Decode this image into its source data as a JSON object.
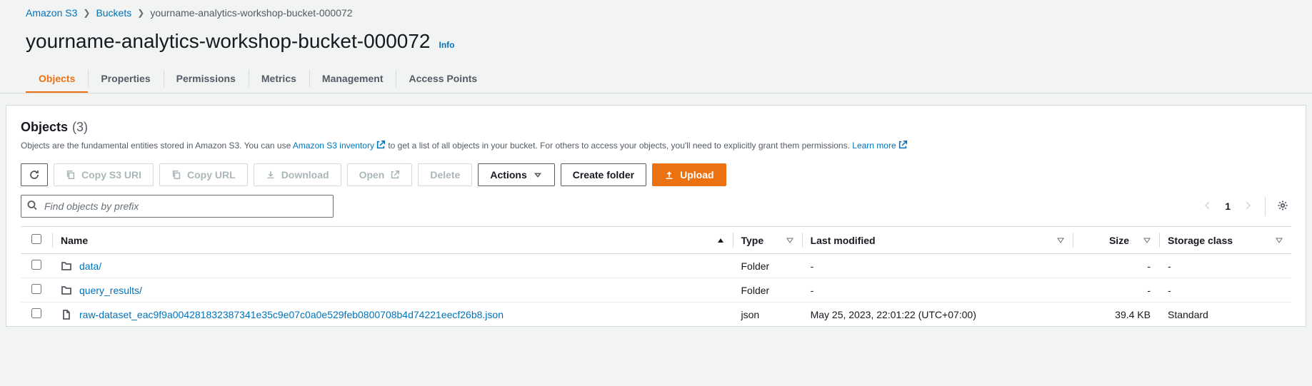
{
  "breadcrumb": {
    "root": "Amazon S3",
    "buckets": "Buckets",
    "current": "yourname-analytics-workshop-bucket-000072"
  },
  "header": {
    "title": "yourname-analytics-workshop-bucket-000072",
    "info_label": "Info"
  },
  "tabs": [
    {
      "label": "Objects",
      "active": true
    },
    {
      "label": "Properties"
    },
    {
      "label": "Permissions"
    },
    {
      "label": "Metrics"
    },
    {
      "label": "Management"
    },
    {
      "label": "Access Points"
    }
  ],
  "panel": {
    "title": "Objects",
    "count": "(3)",
    "desc1": "Objects are the fundamental entities stored in Amazon S3. You can use ",
    "link1": "Amazon S3 inventory",
    "desc2": " to get a list of all objects in your bucket. For others to access your objects, you'll need to explicitly grant them permissions. ",
    "link2": "Learn more"
  },
  "toolbar": {
    "refresh": "Refresh",
    "copy_uri": "Copy S3 URI",
    "copy_url": "Copy URL",
    "download": "Download",
    "open": "Open",
    "delete": "Delete",
    "actions": "Actions",
    "create_folder": "Create folder",
    "upload": "Upload"
  },
  "search": {
    "placeholder": "Find objects by prefix"
  },
  "pagination": {
    "page": "1"
  },
  "columns": {
    "name": "Name",
    "type": "Type",
    "last_modified": "Last modified",
    "size": "Size",
    "storage_class": "Storage class"
  },
  "rows": [
    {
      "icon": "folder",
      "name": "data/",
      "type": "Folder",
      "last_modified": "-",
      "size": "-",
      "storage_class": "-"
    },
    {
      "icon": "folder",
      "name": "query_results/",
      "type": "Folder",
      "last_modified": "-",
      "size": "-",
      "storage_class": "-"
    },
    {
      "icon": "file",
      "name": "raw-dataset_eac9f9a004281832387341e35c9e07c0a0e529feb0800708b4d74221eecf26b8.json",
      "type": "json",
      "last_modified": "May 25, 2023, 22:01:22 (UTC+07:00)",
      "size": "39.4 KB",
      "storage_class": "Standard"
    }
  ]
}
